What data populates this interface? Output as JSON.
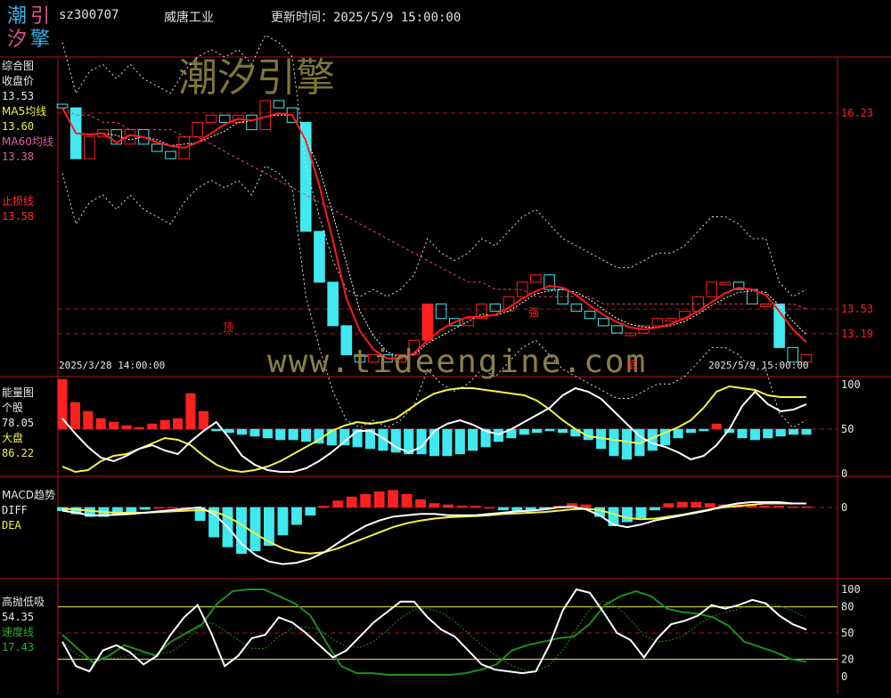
{
  "header": {
    "logo_chars": [
      "潮",
      "引",
      "汐",
      "擎"
    ],
    "code": "sz300707",
    "name": "威唐工业",
    "update_label": "更新时间：",
    "update_time": "2025/5/9 15:00:00"
  },
  "watermark": {
    "brand": "潮汐引擎",
    "url": "www.tideengine.com"
  },
  "colors": {
    "up": "#ff2020",
    "down": "#40e8f0",
    "ma60": "#ff1a1a",
    "yellow": "#f2f24a",
    "white": "#ffffff",
    "green": "#1c8f1c",
    "grid": "#b01515"
  },
  "panels": {
    "main": {
      "title": "综合图",
      "close_label": "收盘价",
      "close_value": "13.53",
      "ma5_label": "MA5均线",
      "ma5_value": "13.60",
      "ma60_label": "MA60均线",
      "ma60_value": "13.38",
      "stop_label": "止损线",
      "stop_value": "13.58",
      "date_start": "2025/3/28 14:00:00",
      "date_end": "2025/5/9 15:00:00",
      "marks": [
        "顶",
        "强",
        "底"
      ]
    },
    "energy": {
      "title": "能量图",
      "stock_label": "个股",
      "stock_value": "78.05",
      "market_label": "大盘",
      "market_value": "86.22"
    },
    "macd": {
      "title": "MACD趋势",
      "diff_label": "DIFF",
      "dea_label": "DEA"
    },
    "oscillator": {
      "title": "高抛低吸",
      "value": "54.35",
      "speed_label": "速度线",
      "speed_value": "17.43"
    }
  },
  "chart_data": [
    {
      "type": "candlestick",
      "title": "综合图",
      "y_axis_ticks": [
        16.23,
        13.53,
        13.19
      ],
      "ylim": [
        12.6,
        17.0
      ],
      "start": "2025/3/28 14:00:00",
      "end": "2025/5/9 15:00:00",
      "bar_count": 56,
      "close": [
        16.3,
        15.6,
        15.9,
        16.0,
        15.8,
        16.0,
        15.8,
        15.7,
        15.6,
        15.9,
        16.1,
        16.2,
        16.1,
        16.2,
        16.0,
        16.4,
        16.3,
        16.1,
        14.6,
        13.9,
        13.3,
        12.9,
        12.8,
        12.9,
        12.8,
        12.9,
        13.1,
        13.6,
        13.4,
        13.3,
        13.4,
        13.6,
        13.5,
        13.7,
        13.9,
        14.0,
        13.8,
        13.6,
        13.5,
        13.4,
        13.3,
        13.2,
        13.2,
        13.3,
        13.4,
        13.4,
        13.5,
        13.7,
        13.9,
        13.9,
        13.8,
        13.6,
        13.6,
        13.0,
        12.8,
        12.9
      ],
      "ma60": [
        16.3,
        16.2,
        16.2,
        16.1,
        16.1,
        16.0,
        16.0,
        16.0,
        16.0,
        15.9,
        15.9,
        15.8,
        15.7,
        15.6,
        15.5,
        15.4,
        15.3,
        15.2,
        15.1,
        15.0,
        14.9,
        14.8,
        14.7,
        14.6,
        14.5,
        14.4,
        14.3,
        14.2,
        14.1,
        14.0,
        13.9,
        13.9,
        13.8,
        13.8,
        13.8,
        13.7,
        13.7,
        13.7,
        13.7,
        13.7,
        13.6,
        13.6,
        13.6,
        13.6,
        13.6,
        13.6,
        13.6,
        13.6,
        13.6,
        13.6,
        13.6,
        13.6,
        13.6,
        13.6,
        13.6,
        13.53
      ],
      "ma5_last": 13.6,
      "ma60_last": 13.38,
      "stop_last": 13.58,
      "close_last": 13.53
    },
    {
      "type": "line+bar",
      "title": "能量图",
      "y_axis_ticks": [
        100,
        50,
        0
      ],
      "ylim": [
        0,
        100
      ],
      "series": [
        {
          "name": "个股",
          "last": 78.05
        },
        {
          "name": "大盘",
          "last": 86.22
        }
      ],
      "stock": [
        62,
        45,
        30,
        18,
        14,
        20,
        28,
        32,
        26,
        22,
        36,
        48,
        58,
        40,
        20,
        10,
        4,
        2,
        2,
        6,
        14,
        24,
        36,
        48,
        48,
        40,
        30,
        24,
        30,
        48,
        56,
        60,
        55,
        48,
        44,
        50,
        58,
        66,
        74,
        88,
        96,
        92,
        84,
        70,
        56,
        42,
        34,
        30,
        24,
        16,
        20,
        32,
        50,
        76,
        92,
        78,
        70,
        72,
        78
      ],
      "market": [
        8,
        2,
        4,
        14,
        20,
        22,
        28,
        34,
        40,
        38,
        32,
        20,
        10,
        4,
        2,
        4,
        8,
        14,
        22,
        30,
        38,
        48,
        54,
        58,
        56,
        58,
        62,
        72,
        82,
        90,
        94,
        96,
        96,
        94,
        92,
        90,
        88,
        82,
        72,
        60,
        50,
        42,
        40,
        38,
        36,
        34,
        40,
        46,
        52,
        60,
        74,
        92,
        98,
        96,
        94,
        88,
        86,
        86,
        86
      ],
      "bars": [
        56,
        30,
        20,
        12,
        8,
        4,
        2,
        6,
        10,
        12,
        40,
        20,
        -2,
        -4,
        -6,
        -8,
        -10,
        -12,
        -12,
        -14,
        -16,
        -18,
        -18,
        -20,
        -22,
        -24,
        -26,
        -28,
        -28,
        -30,
        -30,
        -28,
        -24,
        -20,
        -14,
        -10,
        -6,
        -4,
        -2,
        -4,
        -8,
        -12,
        -22,
        -30,
        -34,
        -30,
        -24,
        -18,
        -10,
        -4,
        -2,
        6,
        -4,
        -10,
        -12,
        -10,
        -8,
        -6,
        -6
      ]
    },
    {
      "type": "line+bar",
      "title": "MACD趋势",
      "y_axis_ticks": [
        0
      ],
      "ylim": [
        -1.0,
        0.35
      ],
      "series": [
        {
          "name": "DIFF"
        },
        {
          "name": "DEA"
        }
      ],
      "diff": [
        -0.05,
        -0.08,
        -0.12,
        -0.12,
        -0.11,
        -0.1,
        -0.08,
        -0.06,
        -0.04,
        -0.02,
        0.0,
        -0.1,
        -0.3,
        -0.55,
        -0.72,
        -0.82,
        -0.86,
        -0.84,
        -0.78,
        -0.68,
        -0.54,
        -0.4,
        -0.28,
        -0.2,
        -0.14,
        -0.12,
        -0.1,
        -0.1,
        -0.12,
        -0.12,
        -0.12,
        -0.1,
        -0.08,
        -0.06,
        -0.05,
        -0.03,
        -0.0,
        0.01,
        -0.03,
        -0.12,
        -0.26,
        -0.3,
        -0.26,
        -0.2,
        -0.16,
        -0.12,
        -0.08,
        -0.04,
        0.02,
        0.06,
        0.08,
        0.08,
        0.08,
        0.06,
        0.06
      ],
      "dea": [
        -0.02,
        -0.03,
        -0.05,
        -0.07,
        -0.08,
        -0.08,
        -0.08,
        -0.07,
        -0.06,
        -0.05,
        -0.04,
        -0.06,
        -0.14,
        -0.26,
        -0.4,
        -0.52,
        -0.62,
        -0.68,
        -0.7,
        -0.68,
        -0.62,
        -0.54,
        -0.46,
        -0.38,
        -0.3,
        -0.24,
        -0.2,
        -0.17,
        -0.15,
        -0.14,
        -0.13,
        -0.12,
        -0.1,
        -0.09,
        -0.08,
        -0.07,
        -0.05,
        -0.03,
        -0.02,
        -0.04,
        -0.1,
        -0.16,
        -0.18,
        -0.17,
        -0.14,
        -0.11,
        -0.07,
        -0.03,
        0.0,
        0.02,
        0.04,
        0.06,
        0.06,
        0.06,
        0.06
      ],
      "bars": [
        -0.05,
        -0.1,
        -0.14,
        -0.14,
        -0.11,
        -0.07,
        -0.03,
        0.0,
        0.0,
        0.0,
        -0.2,
        -0.45,
        -0.6,
        -0.7,
        -0.66,
        -0.58,
        -0.42,
        -0.26,
        -0.12,
        0.02,
        0.1,
        0.16,
        0.2,
        0.24,
        0.26,
        0.2,
        0.12,
        0.06,
        0.04,
        0.02,
        0.02,
        0.0,
        -0.04,
        -0.06,
        -0.04,
        -0.02,
        0.02,
        0.06,
        0.04,
        -0.14,
        -0.28,
        -0.22,
        -0.16,
        -0.04,
        0.06,
        0.08,
        0.08,
        0.06,
        0.04,
        0.04,
        0.04,
        0.02,
        0.02,
        0.01,
        0.01
      ]
    },
    {
      "type": "line",
      "title": "高抛低吸",
      "y_axis_ticks": [
        100,
        80,
        50,
        20,
        0
      ],
      "ylim": [
        0,
        100
      ],
      "series": [
        {
          "name": "高抛低吸",
          "last": 54.35
        },
        {
          "name": "速度线",
          "last": 17.43
        }
      ],
      "fast": [
        40,
        12,
        6,
        30,
        36,
        28,
        14,
        24,
        48,
        68,
        82,
        50,
        12,
        24,
        44,
        48,
        68,
        62,
        50,
        36,
        22,
        30,
        46,
        62,
        74,
        86,
        86,
        68,
        54,
        46,
        30,
        14,
        8,
        6,
        4,
        6,
        36,
        76,
        100,
        96,
        74,
        50,
        42,
        22,
        44,
        60,
        64,
        70,
        82,
        78,
        82,
        88,
        84,
        70,
        60,
        54
      ],
      "speed": [
        48,
        32,
        16,
        24,
        36,
        30,
        24,
        40,
        50,
        60,
        84,
        98,
        100,
        100,
        92,
        84,
        70,
        40,
        12,
        4,
        4,
        2,
        2,
        2,
        2,
        2,
        4,
        8,
        14,
        30,
        36,
        40,
        44,
        46,
        60,
        82,
        92,
        98,
        92,
        78,
        74,
        72,
        68,
        58,
        40,
        34,
        28,
        20,
        17
      ]
    }
  ]
}
